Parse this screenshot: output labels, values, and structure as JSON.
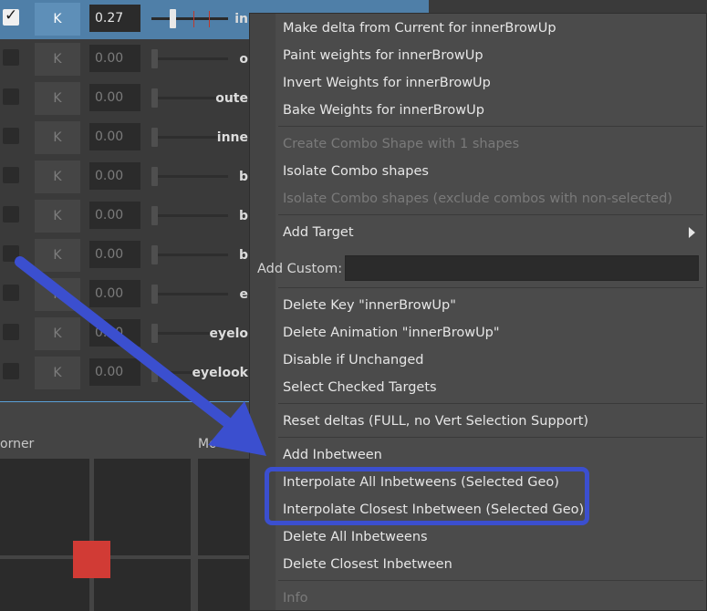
{
  "list": {
    "rows": [
      {
        "checked": true,
        "key_label": "K",
        "value": "0.27",
        "name": "in",
        "selected": true
      },
      {
        "checked": false,
        "key_label": "K",
        "value": "0.00",
        "name": "o"
      },
      {
        "checked": false,
        "key_label": "K",
        "value": "0.00",
        "name": "oute"
      },
      {
        "checked": false,
        "key_label": "K",
        "value": "0.00",
        "name": "inne"
      },
      {
        "checked": false,
        "key_label": "K",
        "value": "0.00",
        "name": "b"
      },
      {
        "checked": false,
        "key_label": "K",
        "value": "0.00",
        "name": "b"
      },
      {
        "checked": false,
        "key_label": "K",
        "value": "0.00",
        "name": "b"
      },
      {
        "checked": false,
        "key_label": "K",
        "value": "0.00",
        "name": "e"
      },
      {
        "checked": false,
        "key_label": "K",
        "value": "0.00",
        "name": "eyelo"
      },
      {
        "checked": false,
        "key_label": "K",
        "value": "0.00",
        "name": "eyelook"
      }
    ]
  },
  "lower": {
    "label_left": "orner",
    "label_right": "Mo"
  },
  "menu": {
    "items": {
      "make_delta": "Make delta from Current for innerBrowUp",
      "paint_weights": "Paint weights for innerBrowUp",
      "invert_weights": "Invert Weights for innerBrowUp",
      "bake_weights": "Bake Weights for innerBrowUp",
      "create_combo": "Create Combo Shape with 1 shapes",
      "isolate_combo": "Isolate Combo shapes",
      "isolate_combo_excl": "Isolate Combo shapes (exclude combos with non-selected)",
      "add_target": "Add Target",
      "add_custom_label": "Add Custom:",
      "add_custom_value": "",
      "delete_key": "Delete Key \"innerBrowUp\"",
      "delete_animation": "Delete Animation \"innerBrowUp\"",
      "disable_unchanged": "Disable if Unchanged",
      "select_checked": "Select Checked Targets",
      "reset_deltas": "Reset deltas (FULL, no Vert Selection Support)",
      "add_inbetween": "Add Inbetween",
      "interpolate_all": "Interpolate All Inbetweens (Selected Geo)",
      "interpolate_closest": "Interpolate Closest Inbetween (Selected Geo)",
      "delete_all_inbetweens": "Delete All Inbetweens",
      "delete_closest_inbetween": "Delete Closest Inbetween",
      "info": "Info"
    }
  },
  "colors": {
    "annotation_blue": "#3b4fcf",
    "selection_blue": "#4f7fa8",
    "marker_red": "#d13b35"
  }
}
